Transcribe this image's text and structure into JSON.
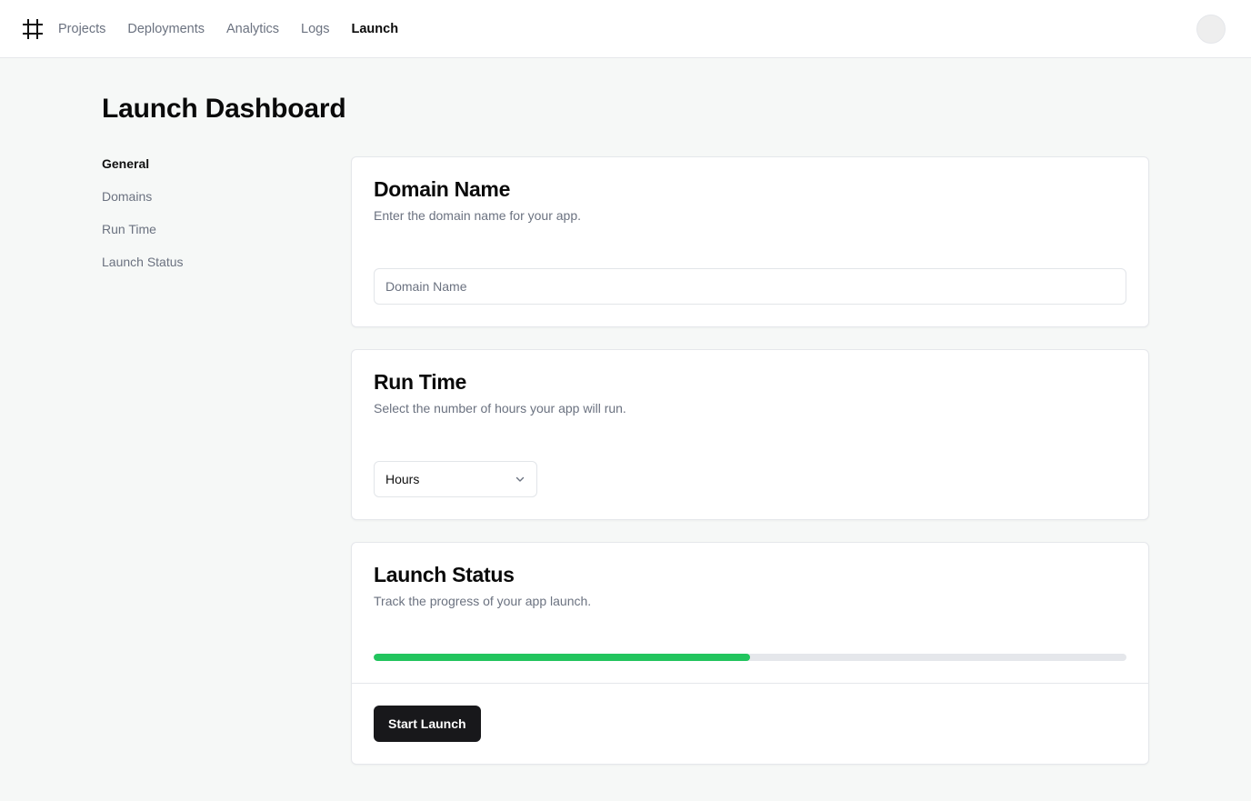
{
  "nav": {
    "items": [
      {
        "label": "Projects",
        "active": false
      },
      {
        "label": "Deployments",
        "active": false
      },
      {
        "label": "Analytics",
        "active": false
      },
      {
        "label": "Logs",
        "active": false
      },
      {
        "label": "Launch",
        "active": true
      }
    ]
  },
  "header": {
    "logo_icon": "hash-icon",
    "avatar_icon": "avatar"
  },
  "page": {
    "title": "Launch Dashboard"
  },
  "sidebar": {
    "items": [
      {
        "label": "General",
        "active": true
      },
      {
        "label": "Domains",
        "active": false
      },
      {
        "label": "Run Time",
        "active": false
      },
      {
        "label": "Launch Status",
        "active": false
      }
    ]
  },
  "domain_card": {
    "title": "Domain Name",
    "description": "Enter the domain name for your app.",
    "input_placeholder": "Domain Name",
    "input_value": ""
  },
  "runtime_card": {
    "title": "Run Time",
    "description": "Select the number of hours your app will run.",
    "select_value": "Hours"
  },
  "status_card": {
    "title": "Launch Status",
    "description": "Track the progress of your app launch.",
    "progress_percent": 50,
    "button_label": "Start Launch"
  },
  "colors": {
    "accent": "#18181b",
    "progress": "#22c55e",
    "track": "#e5e7eb",
    "background": "#f6f8f7"
  }
}
